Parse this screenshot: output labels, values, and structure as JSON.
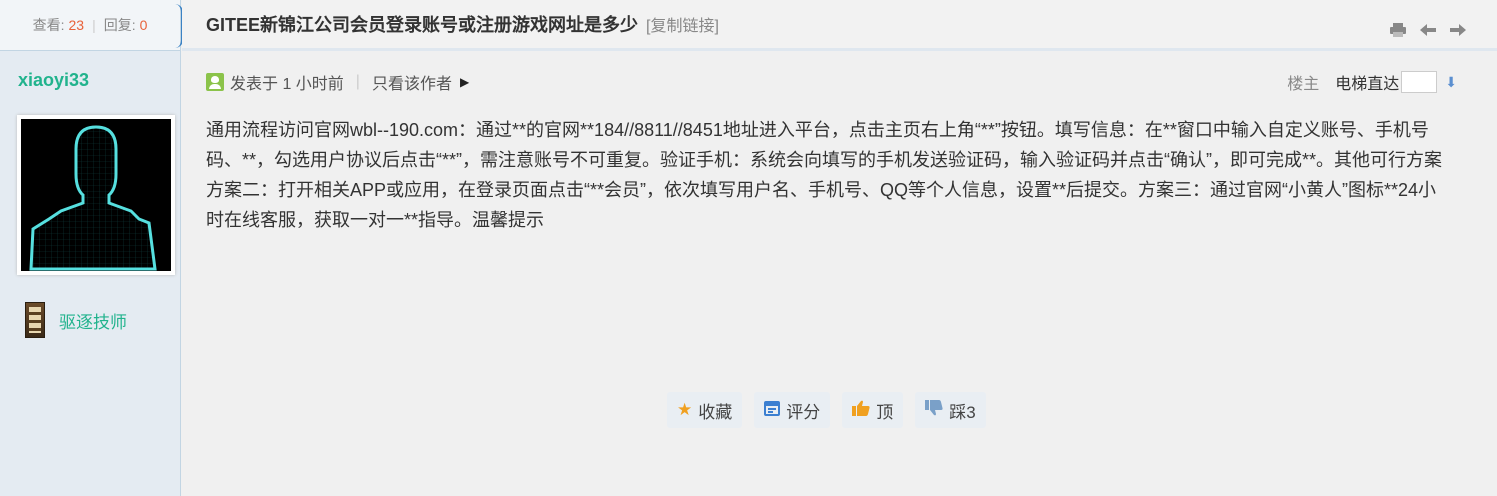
{
  "sidebar": {
    "views_label": "查看:",
    "views_count": "23",
    "replies_label": "回复:",
    "replies_count": "0",
    "author_name": "xiaoyi33",
    "medal_label": "驱逐技师"
  },
  "thread": {
    "title": "GITEE新锦江公司会员登录账号或注册游戏网址是多少",
    "copy_link": "[复制链接]"
  },
  "meta": {
    "posted": "发表于 1 小时前",
    "only_author": "只看该作者",
    "floor_owner": "楼主",
    "elevator": "电梯直达"
  },
  "post": {
    "body": "通用流程访问官网wbl--190.com：通过**的官网**184//8811//8451地址进入平台，点击主页右上角“**”按钮。填写信息：在**窗口中输入自定义账号、手机号码、**，勾选用户协议后点击“**”，需注意账号不可重复。验证手机：系统会向填写的手机发送验证码，输入验证码并点击“确认”，即可完成**。其他可行方案方案二：打开相关APP或应用，在登录页面点击“**会员”，依次填写用户名、手机号、QQ等个人信息，设置**后提交。方案三：通过官网“小黄人”图标**24小时在线客服，获取一对一**指导。温馨提示"
  },
  "actions": {
    "favorite": "收藏",
    "rate": "评分",
    "like": "顶",
    "dislike": "踩3"
  },
  "icons": {
    "print": "print-icon",
    "prev": "arrow-left-icon",
    "next": "arrow-right-icon"
  },
  "colors": {
    "accent_green": "#21b38d",
    "count_orange": "#e8623a",
    "link_blue": "#3b82c4"
  }
}
